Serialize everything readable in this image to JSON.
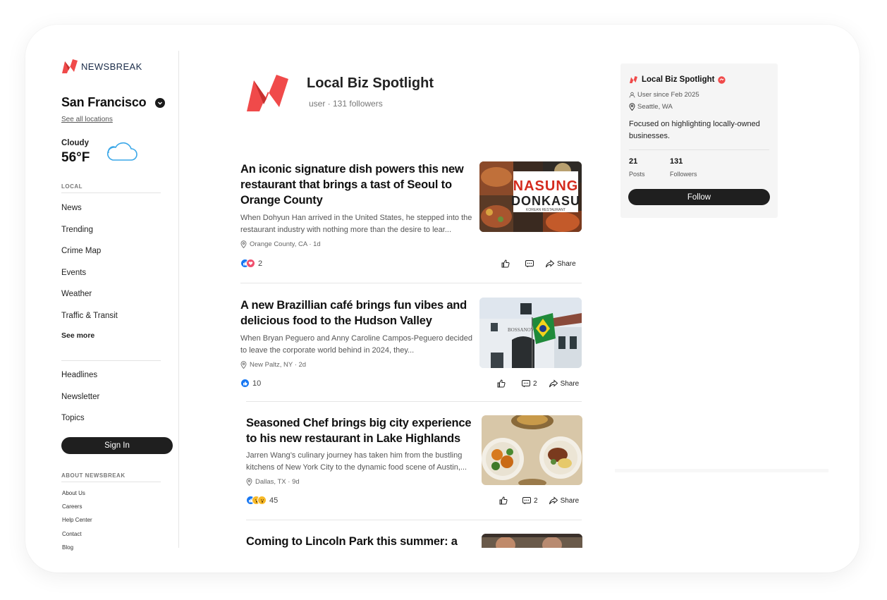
{
  "brand": {
    "name": "NEWSBREAK"
  },
  "sidebar": {
    "location": "San Francisco",
    "see_all_locations": "See all locations",
    "weather": {
      "condition": "Cloudy",
      "temperature": "56°F",
      "icon": "cloud-icon"
    },
    "local_label": "LOCAL",
    "local_items": [
      "News",
      "Trending",
      "Crime Map",
      "Events",
      "Weather",
      "Traffic & Transit"
    ],
    "see_more": "See more",
    "more_items": [
      "Headlines",
      "Newsletter",
      "Topics"
    ],
    "sign_in": "Sign In",
    "about_label": "ABOUT NEWSBREAK",
    "about_items": [
      "About Us",
      "Careers",
      "Help Center",
      "Contact",
      "Blog"
    ]
  },
  "profile": {
    "name": "Local Biz Spotlight",
    "subtitle": "user · 131 followers"
  },
  "articles": [
    {
      "title": "An iconic signature dish powers this new restaurant that brings a tast of Seoul to Orange County",
      "summary": "When Dohyun Han arrived in the United States, he stepped into the restaurant industry with nothing more than the desire to lear...",
      "meta": "Orange County, CA · 1d",
      "reactions": "2",
      "comments": "",
      "share": "Share",
      "thumb_text": {
        "line1": "NASUNG",
        "line2": "DONKASU",
        "line3": "KOREAN RESTAURANT"
      }
    },
    {
      "title": "A new Brazillian café brings fun vibes and delicious food to the Hudson Valley",
      "summary": "When Bryan Peguero and Anny Caroline Campos-Peguero decided to leave the corporate world behind in 2024, they...",
      "meta": "New Paltz, NY · 2d",
      "reactions": "10",
      "comments": "2",
      "share": "Share",
      "thumb_text": {
        "sign": "BOSSANOVA"
      }
    },
    {
      "title": "Seasoned Chef brings big city experience to his new restaurant in Lake Highlands",
      "summary": "Jarren Wang’s culinary journey has taken him from the bustling kitchens of New York City to the dynamic food scene of Austin,...",
      "meta": "Dallas, TX · 9d",
      "reactions": "45",
      "comments": "2",
      "share": "Share"
    },
    {
      "title": "Coming to Lincoln Park this summer: a"
    }
  ],
  "card": {
    "title": "Local Biz Spotlight",
    "since": "User since Feb 2025",
    "city": "Seattle, WA",
    "description": "Focused on highlighting locally-owned businesses.",
    "posts": "21",
    "posts_label": "Posts",
    "followers": "131",
    "followers_label": "Followers",
    "follow": "Follow"
  },
  "colors": {
    "brand_red": "#f04a4a",
    "dark_button": "#1f1f1f",
    "like_blue": "#1877f2"
  }
}
